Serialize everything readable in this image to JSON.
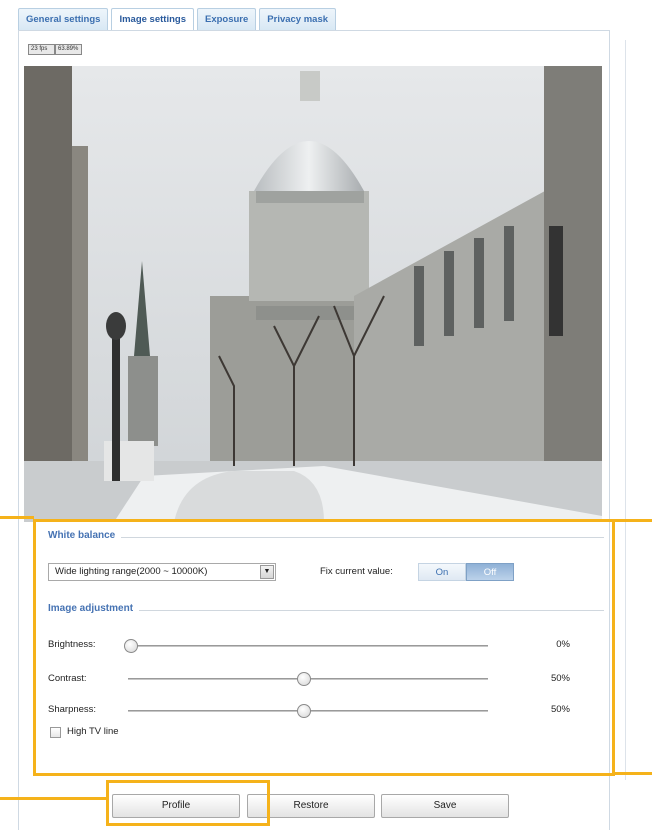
{
  "tabs": [
    {
      "label": "General settings",
      "active": false
    },
    {
      "label": "Image settings",
      "active": true
    },
    {
      "label": "Exposure",
      "active": false
    },
    {
      "label": "Privacy mask",
      "active": false
    }
  ],
  "stream_stats": {
    "rate": "23 fps",
    "percent": "63.89%"
  },
  "white_balance": {
    "title": "White balance",
    "mode": "Wide lighting range(2000 ~ 10000K)",
    "fix_label": "Fix current value:",
    "on_label": "On",
    "off_label": "Off",
    "fix_selected": "Off"
  },
  "image_adjustment": {
    "title": "Image adjustment",
    "sliders": [
      {
        "label": "Brightness:",
        "value": "0%",
        "level": 0
      },
      {
        "label": "Contrast:",
        "value": "50%",
        "level": 0.5
      },
      {
        "label": "Sharpness:",
        "value": "50%",
        "level": 0.5
      }
    ]
  },
  "high_tv_line": {
    "label": "High TV line",
    "checked": false
  },
  "buttons": {
    "profile": "Profile",
    "restore": "Restore",
    "save": "Save"
  },
  "colors": {
    "tab_text": "#3b6fb0",
    "section_title": "#4673b3",
    "highlight": "#f5b21a"
  }
}
